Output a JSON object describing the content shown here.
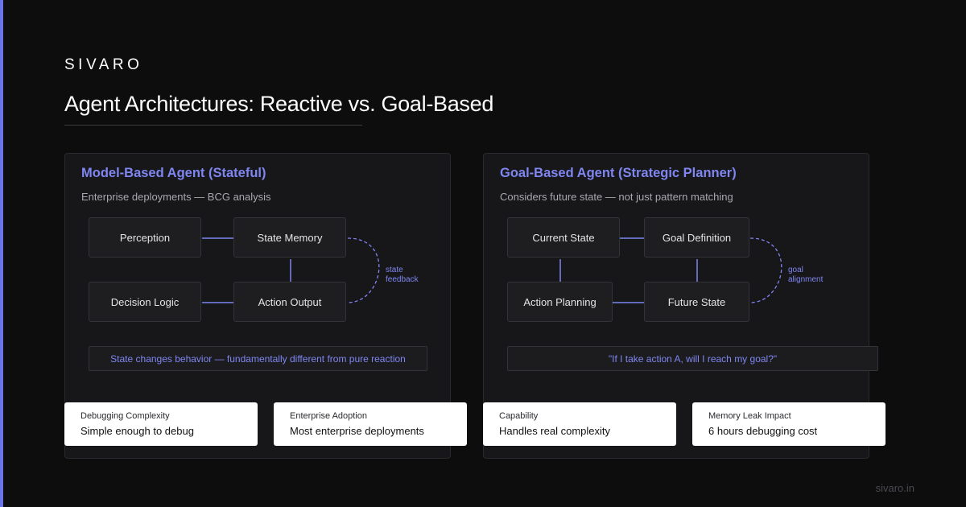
{
  "brand": "SIVARO",
  "title": "Agent Architectures: Reactive vs. Goal-Based",
  "colors": {
    "background": "#0d0d0e",
    "accent": "#7f86f0",
    "panel": "#17171a",
    "card": "#ffffff"
  },
  "panels": {
    "left": {
      "title": "Model-Based Agent (Stateful)",
      "subtitle": "Enterprise deployments — BCG analysis",
      "nodes": [
        "Perception",
        "State Memory",
        "Decision Logic",
        "Action Output"
      ],
      "feedback_label": [
        "state",
        "feedback"
      ],
      "insight": "State changes behavior — fundamentally different from pure reaction"
    },
    "right": {
      "title": "Goal-Based Agent (Strategic Planner)",
      "subtitle": "Considers future state — not just pattern matching",
      "nodes": [
        "Current State",
        "Goal Definition",
        "Action Planning",
        "Future State"
      ],
      "feedback_label": [
        "goal",
        "alignment"
      ],
      "insight": "\"If I take action A, will I reach my goal?\""
    }
  },
  "stats": [
    {
      "label": "Debugging Complexity",
      "value": "Simple enough to debug"
    },
    {
      "label": "Enterprise Adoption",
      "value": "Most enterprise deployments"
    },
    {
      "label": "Capability",
      "value": "Handles real complexity"
    },
    {
      "label": "Memory Leak Impact",
      "value": "6 hours debugging cost"
    }
  ],
  "footer": "sivaro.in"
}
